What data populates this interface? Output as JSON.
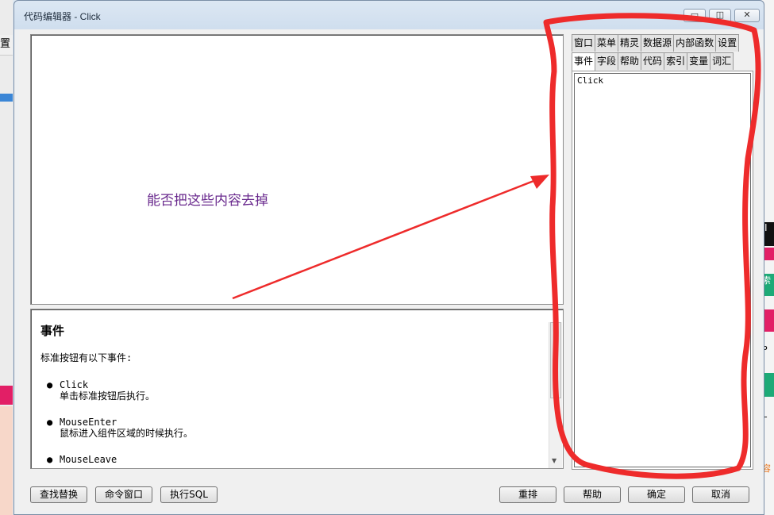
{
  "window": {
    "title": "代码编辑器 - Click",
    "minimize_glyph": "▭",
    "restore_glyph": "◫",
    "close_glyph": "✕"
  },
  "preview": {
    "annotation": "能否把这些内容去掉"
  },
  "help": {
    "heading": "事件",
    "intro": "标准按钮有以下事件:",
    "events": [
      {
        "name": "Click",
        "desc": "单击标准按钮后执行。"
      },
      {
        "name": "MouseEnter",
        "desc": "鼠标进入组件区域的时候执行。"
      },
      {
        "name": "MouseLeave",
        "desc": ""
      }
    ]
  },
  "tabs": {
    "row1": [
      "窗口",
      "菜单",
      "精灵",
      "数据源",
      "内部函数",
      "设置"
    ],
    "row2": [
      "事件",
      "字段",
      "帮助",
      "代码",
      "索引",
      "变量",
      "词汇"
    ],
    "active": "事件",
    "list": [
      "Click"
    ]
  },
  "buttons": {
    "find_replace": "查找替换",
    "command_window": "命令窗口",
    "execute_sql": "执行SQL",
    "rearrange": "重排",
    "help": "帮助",
    "ok": "确定",
    "cancel": "取消"
  },
  "background": {
    "left_label": "置",
    "right_snippets": [
      "I",
      "索",
      "P",
      "L",
      "容"
    ]
  },
  "colors": {
    "annotation_text": "#6a2a8e",
    "annotation_marks": "#ee2b2b"
  }
}
